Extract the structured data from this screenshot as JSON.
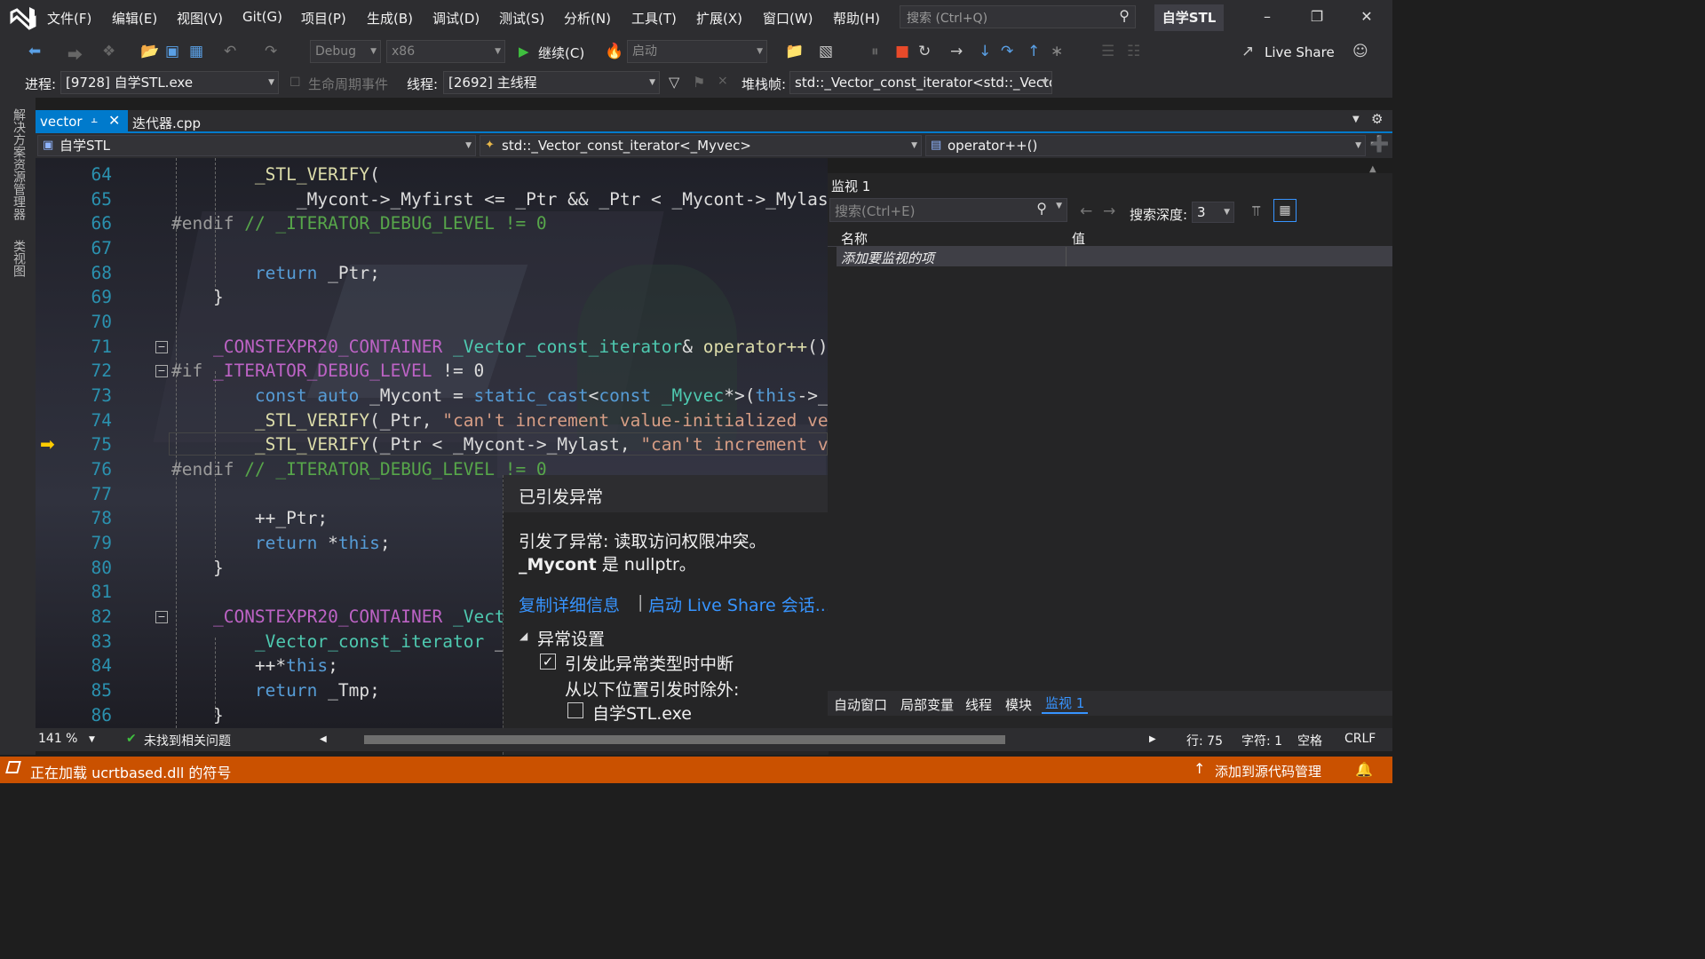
{
  "menubar": {
    "items": [
      "文件(F)",
      "编辑(E)",
      "视图(V)",
      "Git(G)",
      "项目(P)",
      "生成(B)",
      "调试(D)",
      "测试(S)",
      "分析(N)",
      "工具(T)",
      "扩展(X)",
      "窗口(W)",
      "帮助(H)"
    ],
    "search_placeholder": "搜索 (Ctrl+Q)",
    "solution_name": "自学STL"
  },
  "toolbar": {
    "config": "Debug",
    "platform": "x86",
    "continue_label": "继续(C)",
    "startup_item": "启动",
    "live_share_label": "Live Share"
  },
  "debugbar": {
    "process_label": "进程:",
    "process_value": "[9728] 自学STL.exe",
    "lifecycle_label": "生命周期事件",
    "thread_label": "线程:",
    "thread_value": "[2692] 主线程",
    "stackframe_label": "堆栈帧:",
    "stackframe_value": "std::_Vector_const_iterator<std::_Vecto"
  },
  "side_tabs": [
    "解决方案资源管理器",
    "类视图"
  ],
  "doc_tabs": [
    "vector",
    "迭代器.cpp"
  ],
  "navbar": {
    "project": "自学STL",
    "scope": "std::_Vector_const_iterator<_Myvec>",
    "member": "operator++()"
  },
  "code_lines": [
    {
      "n": "64"
    },
    {
      "n": "65"
    },
    {
      "n": "66"
    },
    {
      "n": "67"
    },
    {
      "n": "68"
    },
    {
      "n": "69"
    },
    {
      "n": "70"
    },
    {
      "n": "71"
    },
    {
      "n": "72"
    },
    {
      "n": "73"
    },
    {
      "n": "74"
    },
    {
      "n": "75"
    },
    {
      "n": "76"
    },
    {
      "n": "77"
    },
    {
      "n": "78"
    },
    {
      "n": "79"
    },
    {
      "n": "80"
    },
    {
      "n": "81"
    },
    {
      "n": "82"
    },
    {
      "n": "83"
    },
    {
      "n": "84"
    },
    {
      "n": "85"
    },
    {
      "n": "86"
    }
  ],
  "exception_popup": {
    "title": "已引发异常",
    "message_line1": "引发了异常: 读取访问权限冲突。",
    "message_var": "_Mycont",
    "message_line2_suffix": " 是 nullptr。",
    "link_copy": "复制详细信息",
    "link_liveshare": "启动 Live Share 会话...",
    "settings_header": "异常设置",
    "break_option": "引发此异常类型时中断",
    "except_label": "从以下位置引发时除外:",
    "module_option": "自学STL.exe",
    "break_checked": true,
    "module_checked": false
  },
  "watch": {
    "title": "监视 1",
    "search_placeholder": "搜索(Ctrl+E)",
    "depth_label": "搜索深度:",
    "depth_value": "3",
    "col_name": "名称",
    "col_value": "值",
    "add_item_label": "添加要监视的项",
    "tabs": [
      "自动窗口",
      "局部变量",
      "线程",
      "模块",
      "监视 1"
    ]
  },
  "editor_status": {
    "zoom": "141 %",
    "issues": "未找到相关问题",
    "line": "行: 75",
    "col": "字符: 1",
    "spaces": "空格",
    "eol": "CRLF"
  },
  "statusbar": {
    "loading": "正在加载 ucrtbased.dll 的符号",
    "source_control": "添加到源代码管理"
  },
  "colors": {
    "accent": "#007acc",
    "status_bar": "#ca5100",
    "link": "#3794ff",
    "line_number": "#2b91af"
  }
}
